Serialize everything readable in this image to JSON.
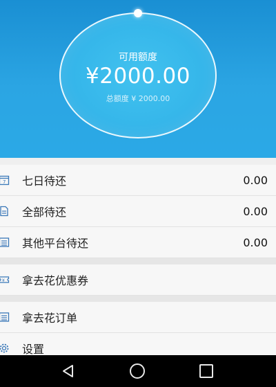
{
  "credit": {
    "available_label": "可用额度",
    "available_amount": "¥2000.00",
    "total_label": "总额度",
    "total_amount": "¥ 2000.00",
    "progress_fraction": 0
  },
  "menu": {
    "group1": [
      {
        "label": "七日待还",
        "value": "0.00",
        "icon": "calendar-icon"
      },
      {
        "label": "全部待还",
        "value": "0.00",
        "icon": "document-icon"
      },
      {
        "label": "其他平台待还",
        "value": "0.00",
        "icon": "list-icon"
      }
    ],
    "coupon": {
      "label": "拿去花优惠券",
      "icon": "ticket-icon"
    },
    "orders": {
      "label": "拿去花订单",
      "icon": "list-icon"
    },
    "settings": {
      "label": "设置",
      "icon": "gear-icon"
    }
  },
  "colors": {
    "header": "#1a8fd3",
    "circle": "#35b6ea",
    "icon": "#3a78b8"
  }
}
